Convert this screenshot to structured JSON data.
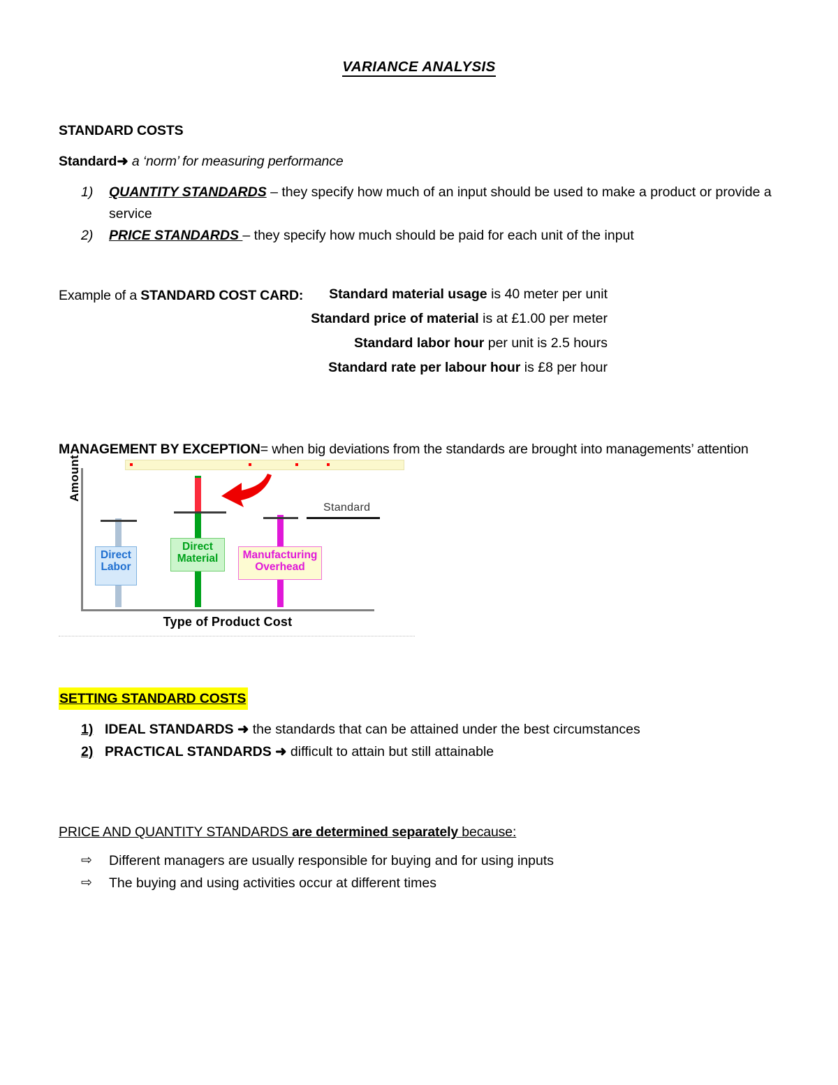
{
  "document": {
    "title": "VARIANCE ANALYSIS"
  },
  "standard_costs": {
    "heading": "STANDARD COSTS",
    "definition_term": "Standard",
    "definition_arrow": "➜",
    "definition_text": "a ‘norm’ for measuring performance",
    "items": [
      {
        "number": "1)",
        "term": "QUANTITY STANDARDS",
        "text": " – they specify how much of an input should be used to make a product or provide a service"
      },
      {
        "number": "2)",
        "term": "PRICE STANDARDS ",
        "text": "– they specify how much should be paid for each unit of the input"
      }
    ]
  },
  "cost_card": {
    "label_prefix": "Example of a ",
    "label_bold": "STANDARD COST CARD:",
    "lines": [
      {
        "bold": "Standard material usage",
        "rest": " is 40 meter per unit"
      },
      {
        "bold": "Standard price of material",
        "rest": " is at £1.00 per meter"
      },
      {
        "bold": "Standard labor hour",
        "rest": " per unit is 2.5 hours"
      },
      {
        "bold": "Standard rate per labour hour",
        "rest": " is £8 per hour"
      }
    ]
  },
  "management_by_exception": {
    "bold": "MANAGEMENT BY EXCEPTION",
    "rest": "= when big deviations from the standards are brought into managements’ attention"
  },
  "chart_data": {
    "type": "bar",
    "title": "",
    "xlabel": "Type of Product Cost",
    "ylabel": "Amount",
    "categories": [
      "Direct Labor",
      "Direct Material",
      "Manufacturing Overhead"
    ],
    "values": [
      58,
      95,
      72
    ],
    "standards": [
      66,
      72,
      72
    ],
    "standard_annotation": "Standard",
    "ylim": [
      0,
      120
    ],
    "grid": false,
    "legend": "none",
    "colors": {
      "direct_labor_bar": "#aec2d6",
      "direct_labor_box_fill": "#d6e9fa",
      "direct_labor_box_border": "#7fb2e0",
      "direct_labor_text": "#1f6fd0",
      "direct_material_bar": "#00a21b",
      "direct_material_overage": "#fb2c3c",
      "direct_material_box_fill": "#ccf5cc",
      "direct_material_box_border": "#6fce6f",
      "direct_material_text": "#00a21b",
      "mfg_overhead_bar": "#e018d8",
      "mfg_overhead_box_fill": "#fdfbd2",
      "mfg_overhead_box_border": "#f06fd8",
      "mfg_overhead_text": "#e018d8",
      "standard_tick": "#333333",
      "axis": "#808080",
      "arrow": "#ee0000",
      "banner_fill": "#fbf8cd"
    },
    "labels": {
      "direct_labor": "Direct\nLabor",
      "direct_labor_line1": "Direct",
      "direct_labor_line2": "Labor",
      "direct_material_line1": "Direct",
      "direct_material_line2": "Material",
      "mfg_overhead_line1": "Manufacturing",
      "mfg_overhead_line2": "Overhead"
    }
  },
  "setting_standard_costs": {
    "heading": "SETTING STANDARD COSTS",
    "items": [
      {
        "number": "1)",
        "term": "IDEAL STANDARDS",
        "arrow": "➜",
        "text": " the standards that can be attained under the best circumstances"
      },
      {
        "number": "2)",
        "term": "PRACTICAL STANDARDS",
        "arrow": "➜",
        "text": "  difficult to attain but still attainable"
      }
    ]
  },
  "price_and_quantity": {
    "heading_plain": "PRICE AND QUANTITY STANDARDS ",
    "heading_bold": "are determined separately",
    "heading_tail": " because:",
    "bullet_glyph": "⇨",
    "items": [
      "Different managers are usually responsible for buying and for using inputs",
      "The buying and using activities occur at different times"
    ]
  }
}
